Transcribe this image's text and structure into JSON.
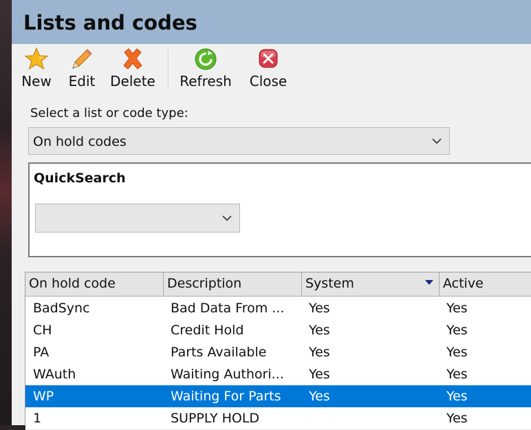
{
  "window": {
    "title": "Lists and codes"
  },
  "toolbar": {
    "new_label": "New",
    "edit_label": "Edit",
    "delete_label": "Delete",
    "refresh_label": "Refresh",
    "close_label": "Close",
    "icons": {
      "new": "star-icon",
      "edit": "pencil-icon",
      "delete": "x-delete-icon",
      "refresh": "refresh-icon",
      "close": "close-icon"
    }
  },
  "list_selector": {
    "label": "Select a list or code type:",
    "value": "On hold codes"
  },
  "quicksearch": {
    "title": "QuickSearch",
    "value": ""
  },
  "grid": {
    "columns": [
      "On hold code",
      "Description",
      "System",
      "Active"
    ],
    "rows": [
      {
        "code": "BadSync",
        "description": "Bad Data From ...",
        "system": "Yes",
        "active": "Yes",
        "selected": false
      },
      {
        "code": "CH",
        "description": "Credit Hold",
        "system": "Yes",
        "active": "Yes",
        "selected": false
      },
      {
        "code": "PA",
        "description": "Parts Available",
        "system": "Yes",
        "active": "Yes",
        "selected": false
      },
      {
        "code": "WAuth",
        "description": "Waiting Authori...",
        "system": "Yes",
        "active": "Yes",
        "selected": false
      },
      {
        "code": "WP",
        "description": "Waiting For Parts",
        "system": "Yes",
        "active": "Yes",
        "selected": true
      },
      {
        "code": "1",
        "description": "SUPPLY HOLD",
        "system": "",
        "active": "Yes",
        "selected": false
      }
    ]
  },
  "colors": {
    "title_bar": "#9bb4d0",
    "selection": "#0078d7"
  }
}
